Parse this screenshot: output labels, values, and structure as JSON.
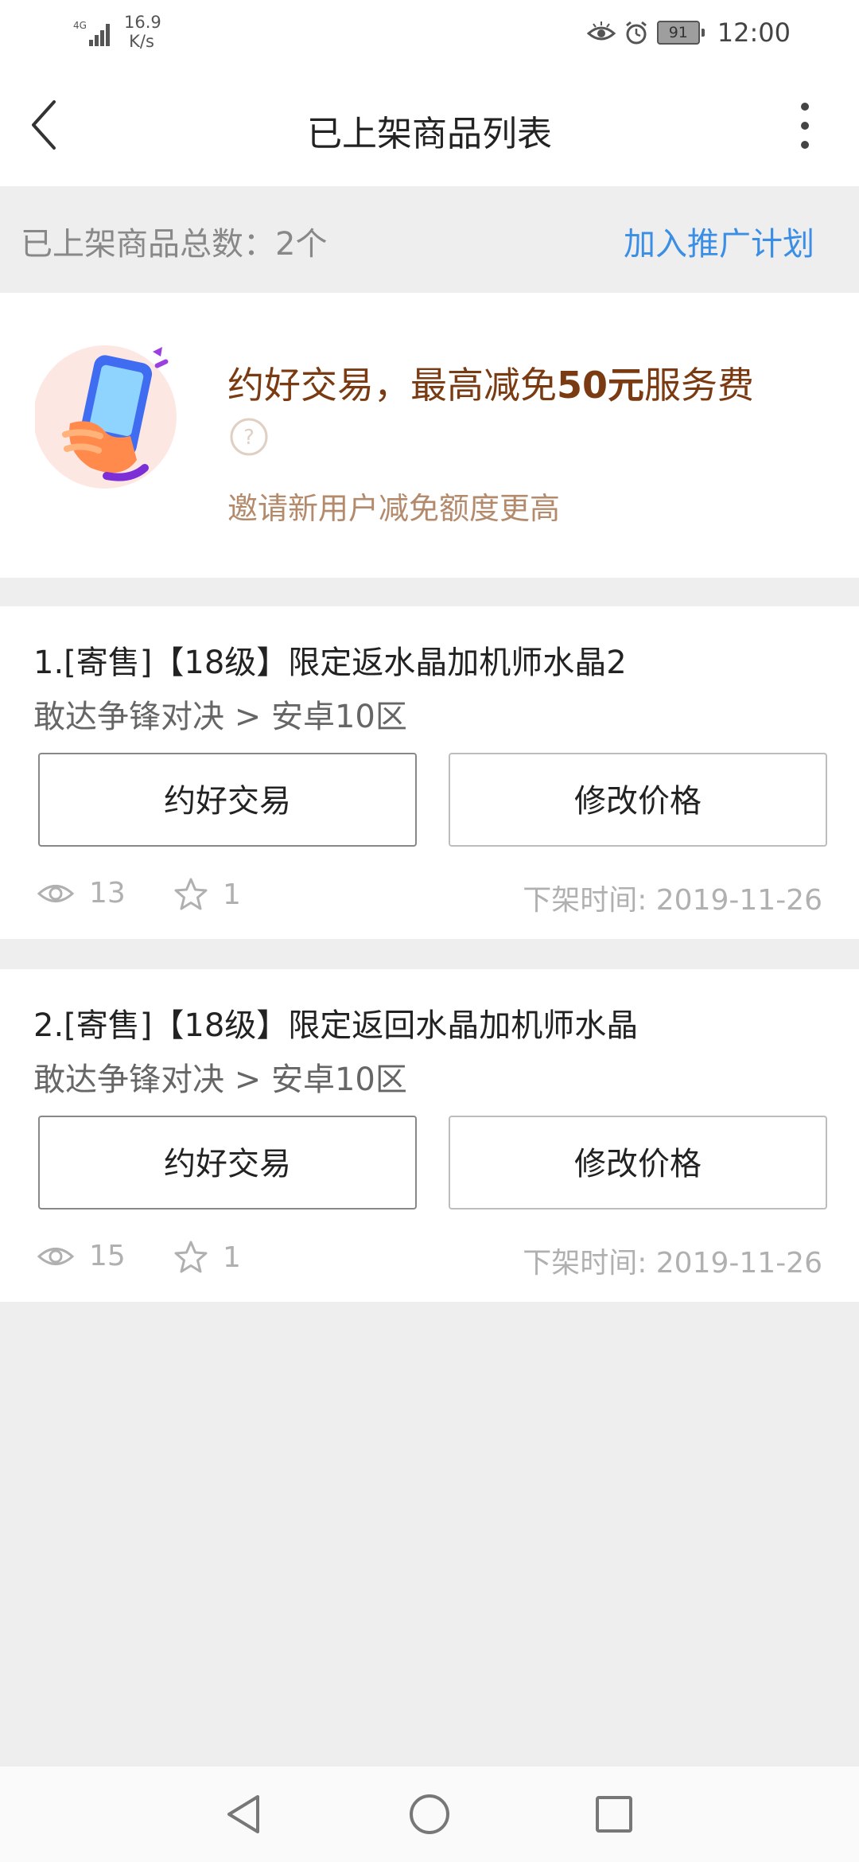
{
  "status_bar": {
    "network": "4G",
    "speed_value": "16.9",
    "speed_unit": "K/s",
    "battery": "91",
    "time": "12:00"
  },
  "header": {
    "title": "已上架商品列表"
  },
  "summary": {
    "count_label": "已上架商品总数：2个",
    "promo_link": "加入推广计划"
  },
  "promo": {
    "title_prefix": "约好交易，最高减免",
    "title_amount": "50元",
    "title_suffix": "服务费",
    "subtitle": "邀请新用户减免额度更高"
  },
  "listings": [
    {
      "title": "1.[寄售]【18级】限定返水晶加机师水晶2",
      "subtitle": "敢达争锋对决 > 安卓10区",
      "deal_button": "约好交易",
      "price_button": "修改价格",
      "views": "13",
      "favorites": "1",
      "delist_time": "下架时间: 2019-11-26"
    },
    {
      "title": "2.[寄售]【18级】限定返回水晶加机师水晶",
      "subtitle": "敢达争锋对决 > 安卓10区",
      "deal_button": "约好交易",
      "price_button": "修改价格",
      "views": "15",
      "favorites": "1",
      "delist_time": "下架时间: 2019-11-26"
    }
  ],
  "icons": {
    "back": "chevron-left-icon",
    "more": "more-vertical-icon",
    "help": "question-circle-icon",
    "views": "eye-icon",
    "favorites": "star-icon"
  },
  "colors": {
    "accent_link": "#3a8ee6",
    "promo_title": "#7a3a12",
    "promo_sub": "#b48a6c"
  }
}
